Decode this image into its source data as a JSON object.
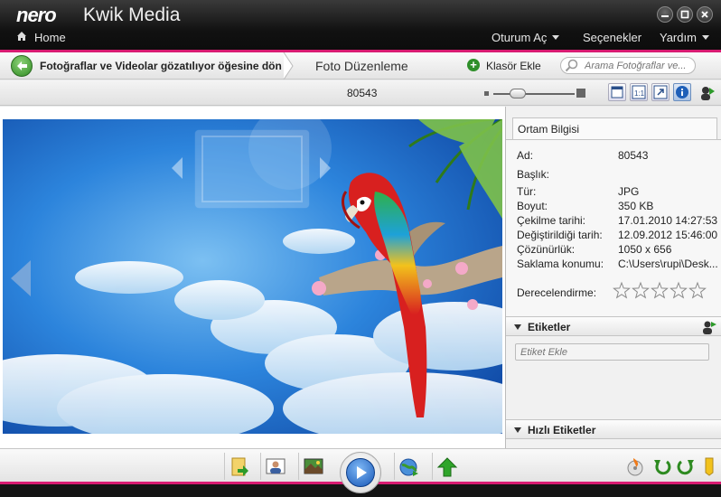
{
  "titlebar": {
    "brand": "nero",
    "app_name": "Kwik Media",
    "home_label": "Home",
    "menus": [
      {
        "label": "Oturum Aç",
        "has_caret": true
      },
      {
        "label": "Seçenekler",
        "has_caret": false
      },
      {
        "label": "Yardım",
        "has_caret": true
      }
    ],
    "window_buttons": [
      "minimize-icon",
      "maximize-icon",
      "close-icon"
    ]
  },
  "navbar": {
    "back_label": "Fotoğraflar ve Videolar gözatılıyor öğesine dön",
    "breadcrumb": "Foto Düzenleme",
    "add_folder_label": "Klasör Ekle",
    "search_placeholder": "Arama Fotoğraflar ve..."
  },
  "toolbar": {
    "file_name": "80543",
    "zoom_level": 0.3,
    "view_buttons": [
      "fit-window-icon",
      "actual-size-icon",
      "fullscreen-icon",
      "info-icon",
      "share-icon"
    ]
  },
  "panel": {
    "tab_label": "Ortam Bilgisi",
    "fields": [
      {
        "label": "Ad:",
        "value": "80543"
      },
      {
        "label": "Başlık:",
        "value": ""
      },
      {
        "label": "Tür:",
        "value": "JPG"
      },
      {
        "label": "Boyut:",
        "value": "350 KB"
      },
      {
        "label": "Çekilme tarihi:",
        "value": "17.01.2010 14:27:53"
      },
      {
        "label": "Değiştirildiği tarih:",
        "value": "12.09.2012 15:46:00"
      },
      {
        "label": "Çözünürlük:",
        "value": "1050 x 656"
      },
      {
        "label": "Saklama konumu:",
        "value": "C:\\Users\\rupi\\Desk..."
      }
    ],
    "rating_label": "Derecelendirme:",
    "rating": 0,
    "rating_max": 5,
    "tags_header": "Etiketler",
    "tag_placeholder": "Etiket Ekle",
    "quick_tags_header": "Hızlı Etiketler"
  },
  "bottombar": {
    "tools": [
      "import-icon",
      "people-icon",
      "photo-edit-icon",
      "play-icon",
      "web-share-icon",
      "upload-icon"
    ],
    "right_tools": [
      "burn-icon",
      "rotate-left-icon",
      "rotate-right-icon",
      "tag-icon"
    ]
  },
  "colors": {
    "accent": "#d81b72",
    "titlebar": "#111111",
    "sky": "#1e6fd0"
  }
}
